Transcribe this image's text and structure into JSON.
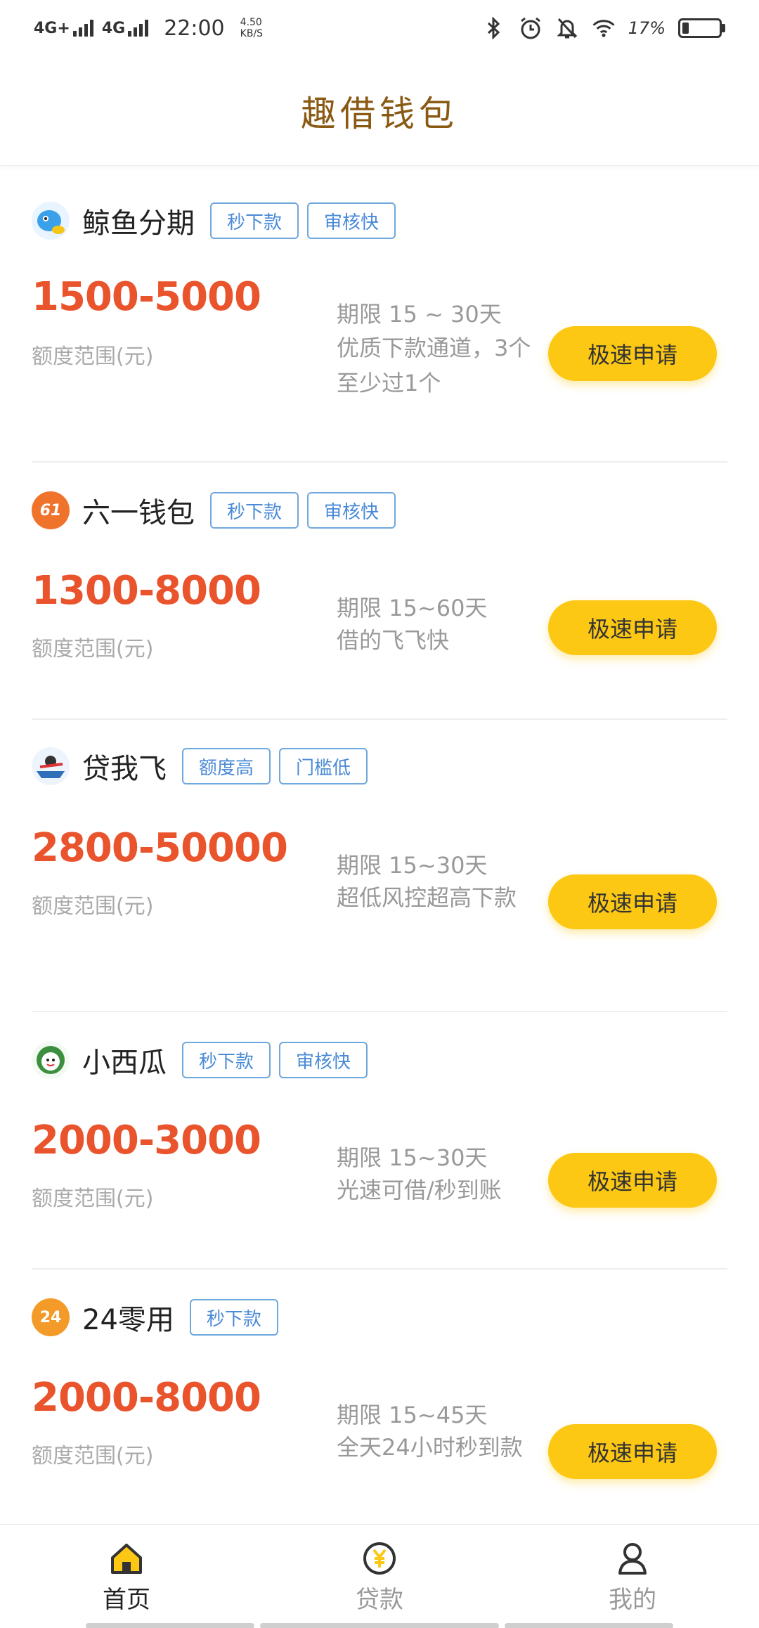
{
  "status_bar": {
    "network1": "4G+",
    "network2": "4G",
    "time": "22:00",
    "speed_value": "4.50",
    "speed_unit": "KB/S",
    "battery": "17%"
  },
  "header": {
    "title": "趣借钱包"
  },
  "products": [
    {
      "name": "鲸鱼分期",
      "logo_text": "",
      "logo_color": "#3aa0ea",
      "tags": [
        "秒下款",
        "审核快"
      ],
      "range": "1500-5000",
      "range_label": "额度范围(元)",
      "term": "期限 15 ~ 30天",
      "desc": "优质下款通道，3个至少过1个",
      "button": "极速申请"
    },
    {
      "name": "六一钱包",
      "logo_text": "61",
      "logo_color": "#f0732c",
      "tags": [
        "秒下款",
        "审核快"
      ],
      "range": "1300-8000",
      "range_label": "额度范围(元)",
      "term": "期限 15~60天",
      "desc": "借的飞飞快",
      "button": "极速申请"
    },
    {
      "name": "贷我飞",
      "logo_text": "",
      "logo_color": "#2f6fb8",
      "tags": [
        "额度高",
        "门槛低"
      ],
      "range": "2800-50000",
      "range_label": "额度范围(元)",
      "term": "期限 15~30天",
      "desc": "超低风控超高下款",
      "button": "极速申请"
    },
    {
      "name": "小西瓜",
      "logo_text": "",
      "logo_color": "#3b8f3e",
      "tags": [
        "秒下款",
        "审核快"
      ],
      "range": "2000-3000",
      "range_label": "额度范围(元)",
      "term": "期限 15~30天",
      "desc": "光速可借/秒到账",
      "button": "极速申请"
    },
    {
      "name": "24零用",
      "logo_text": "24",
      "logo_color": "#f49a28",
      "tags": [
        "秒下款"
      ],
      "range": "2000-8000",
      "range_label": "额度范围(元)",
      "term": "期限 15~45天",
      "desc": "全天24小时秒到款",
      "button": "极速申请"
    }
  ],
  "bottom_nav": [
    {
      "label": "首页",
      "icon": "home-icon",
      "active": true
    },
    {
      "label": "贷款",
      "icon": "yuan-coin-icon",
      "active": false
    },
    {
      "label": "我的",
      "icon": "user-icon",
      "active": false
    }
  ],
  "colors": {
    "accent_button": "#fcc814",
    "range_text": "#e9542d",
    "tag_border": "#6fa8dc",
    "header_title": "#8a5a14"
  }
}
